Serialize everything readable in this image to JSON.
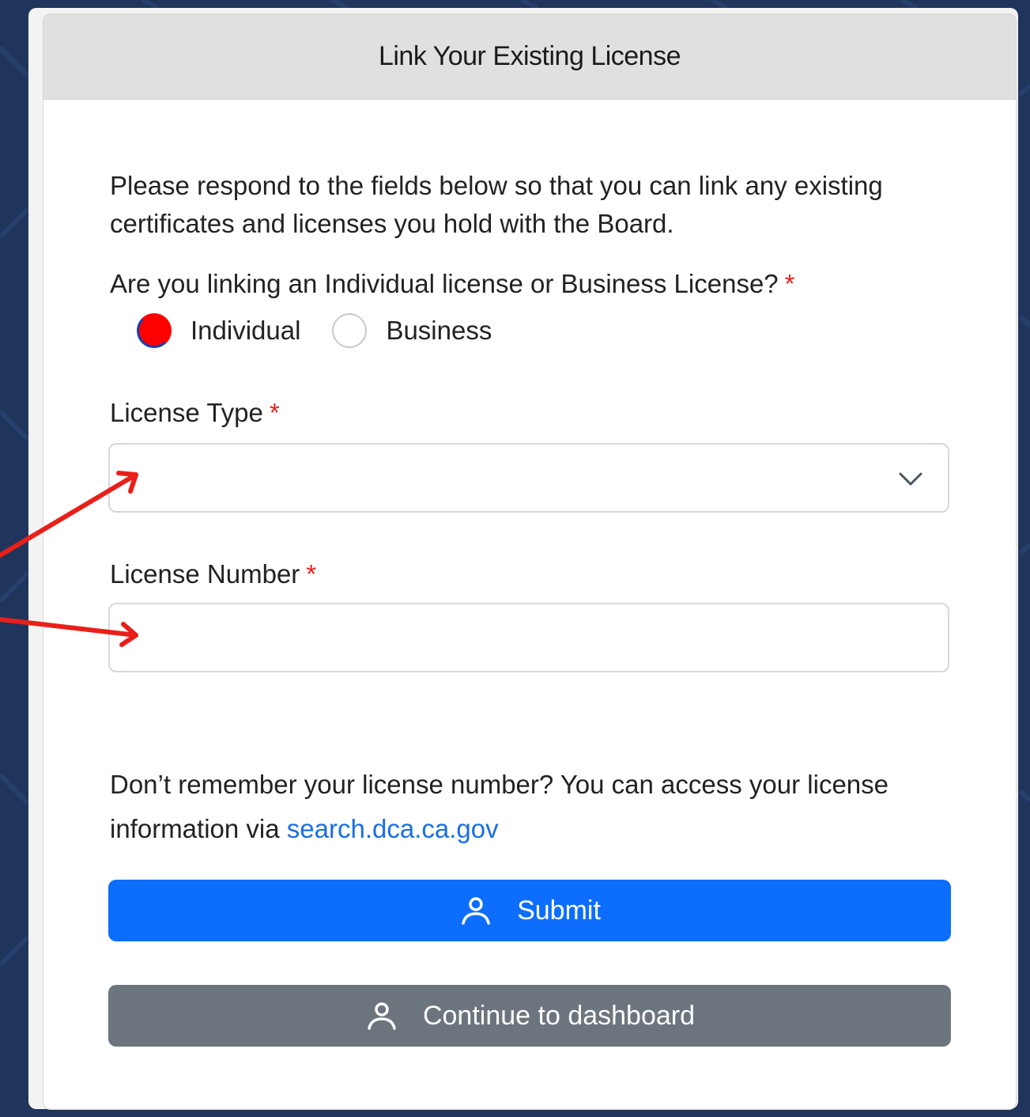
{
  "card": {
    "title": "Link Your Existing License"
  },
  "intro": "Please respond to the fields below so that you can link any existing certificates and licenses you hold with the Board.",
  "question": {
    "text": "Are you linking an Individual license or Business License?",
    "required_mark": "*",
    "options": [
      {
        "label": "Individual",
        "selected": true
      },
      {
        "label": "Business",
        "selected": false
      }
    ]
  },
  "license_type": {
    "label": "License Type",
    "required_mark": "*",
    "value": ""
  },
  "license_number": {
    "label": "License Number",
    "required_mark": "*",
    "value": ""
  },
  "help": {
    "text": "Don’t remember your license number? You can access your license information via",
    "link_text": "search.dca.ca.gov"
  },
  "buttons": {
    "submit": "Submit",
    "dashboard": "Continue to dashboard"
  },
  "colors": {
    "primary": "#0d6efd",
    "secondary": "#6c757d",
    "required": "#e8201a",
    "radio_selected": "#ff0000",
    "link": "#1a6fe0",
    "annotation_arrow": "#e8201a",
    "background": "#1f355c"
  },
  "icons": {
    "button_icon": "user-icon",
    "select_icon": "chevron-down-icon"
  }
}
